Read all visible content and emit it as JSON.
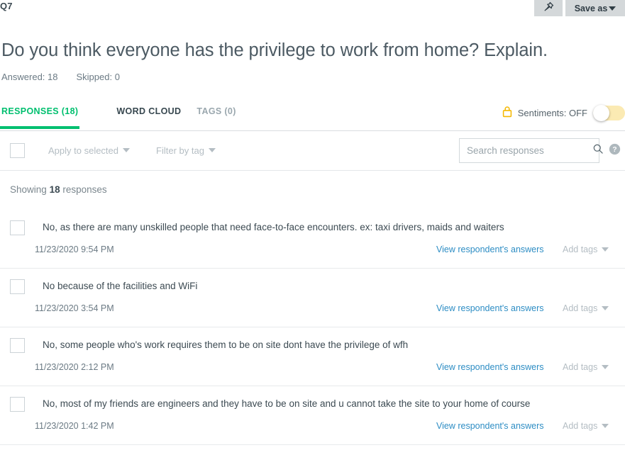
{
  "header": {
    "question_number": "Q7",
    "pin_icon": "pin-icon",
    "save_as_label": "Save as",
    "dropdown_icon": "caret-down-icon"
  },
  "question": {
    "title": "Do you think everyone has the privilege to work from home? Explain.",
    "answered_label": "Answered: 18",
    "skipped_label": "Skipped: 0"
  },
  "tabs": [
    {
      "label": "RESPONSES (18)",
      "state": "active"
    },
    {
      "label": "WORD CLOUD",
      "state": "normal"
    },
    {
      "label": "TAGS (0)",
      "state": "muted"
    }
  ],
  "sentiments": {
    "lock_icon": "lock-icon",
    "label": "Sentiments: OFF",
    "toggle_state": "off"
  },
  "toolbar": {
    "apply_to_selected": "Apply to selected",
    "filter_by_tag": "Filter by tag",
    "search_placeholder": "Search responses",
    "search_value": "",
    "search_icon": "search-icon",
    "help_icon": "help-circle-icon"
  },
  "list": {
    "showing_prefix": "Showing",
    "showing_count": "18",
    "showing_suffix": "responses",
    "view_link_label": "View respondent's answers",
    "add_tags_label": "Add tags",
    "responses": [
      {
        "text": "No, as there are many unskilled people that need face-to-face encounters. ex: taxi drivers, maids and waiters",
        "date": "11/23/2020 9:54 PM"
      },
      {
        "text": "No because of the facilities and WiFi",
        "date": "11/23/2020 3:54 PM"
      },
      {
        "text": "No, some people who's work requires them to be on site dont have the privilege of wfh",
        "date": "11/23/2020 2:12 PM"
      },
      {
        "text": "No, most of my friends are engineers and they have to be on site and u cannot take the site to your home of course",
        "date": "11/23/2020 1:42 PM"
      }
    ]
  },
  "colors": {
    "accent_green": "#00bf6f",
    "link_blue": "#2d8dc4",
    "lock_yellow": "#f5b800",
    "toggle_track": "#fbeab3",
    "button_gray": "#d4d8da",
    "text_dark": "#3c4a52",
    "text_muted": "#b4bdc3"
  }
}
